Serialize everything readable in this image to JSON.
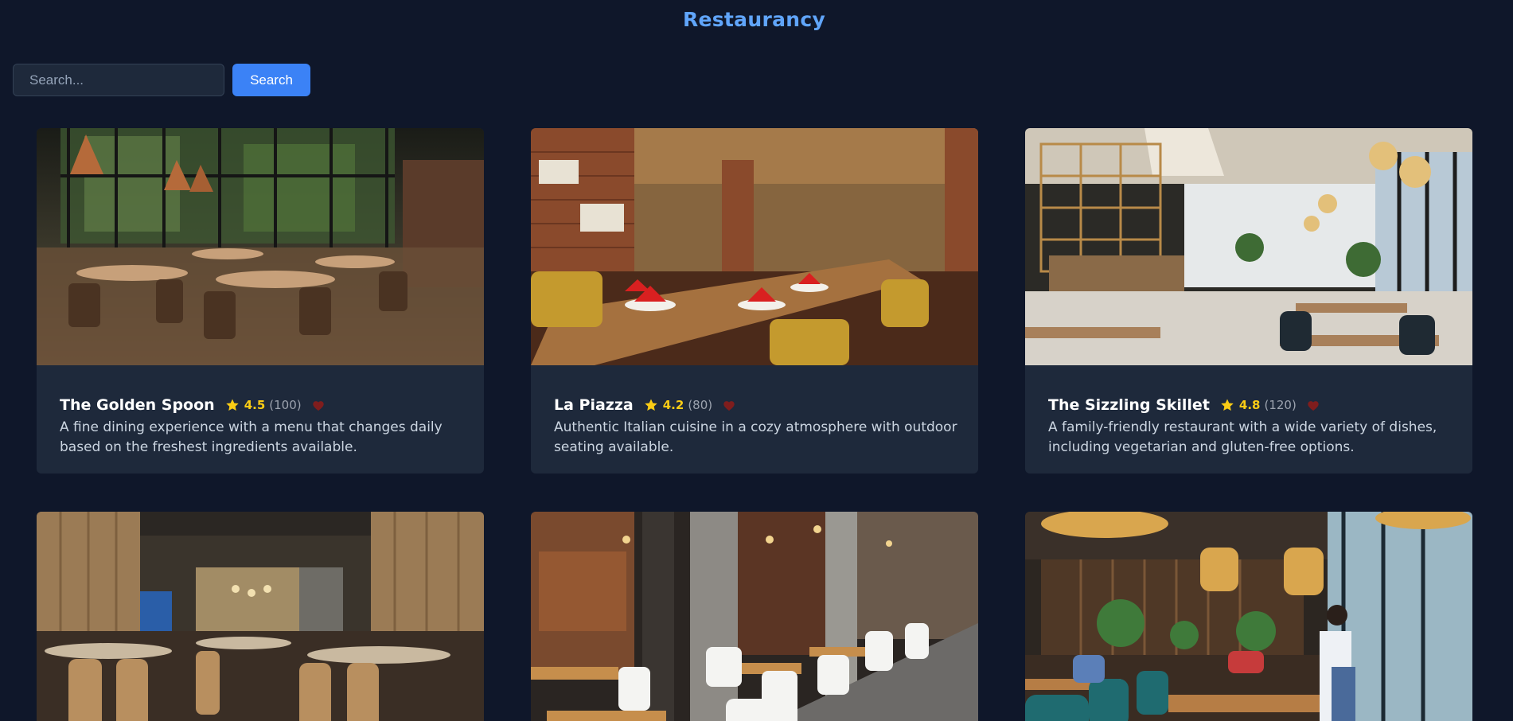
{
  "app": {
    "title": "Restaurancy"
  },
  "search": {
    "placeholder": "Search...",
    "button_label": "Search"
  },
  "colors": {
    "background": "#0f172a",
    "card": "#1e293b",
    "accent": "#3b82f6",
    "brand": "#60a5fa",
    "rating": "#facc15"
  },
  "icons": {
    "rating": "star-icon",
    "favorite": "heart-icon"
  },
  "restaurants": [
    {
      "name": "The Golden Spoon",
      "rating": "4.5",
      "reviews": "(100)",
      "description": "A fine dining experience with a menu that changes daily based on the freshest ingredients available.",
      "image": "restaurant interior photo"
    },
    {
      "name": "La Piazza",
      "rating": "4.2",
      "reviews": "(80)",
      "description": "Authentic Italian cuisine in a cozy atmosphere with outdoor seating available.",
      "image": "restaurant interior photo"
    },
    {
      "name": "The Sizzling Skillet",
      "rating": "4.8",
      "reviews": "(120)",
      "description": "A family-friendly restaurant with a wide variety of dishes, including vegetarian and gluten-free options.",
      "image": "restaurant interior photo"
    },
    {
      "image": "restaurant interior photo"
    },
    {
      "image": "restaurant interior photo"
    },
    {
      "image": "restaurant interior photo"
    }
  ]
}
